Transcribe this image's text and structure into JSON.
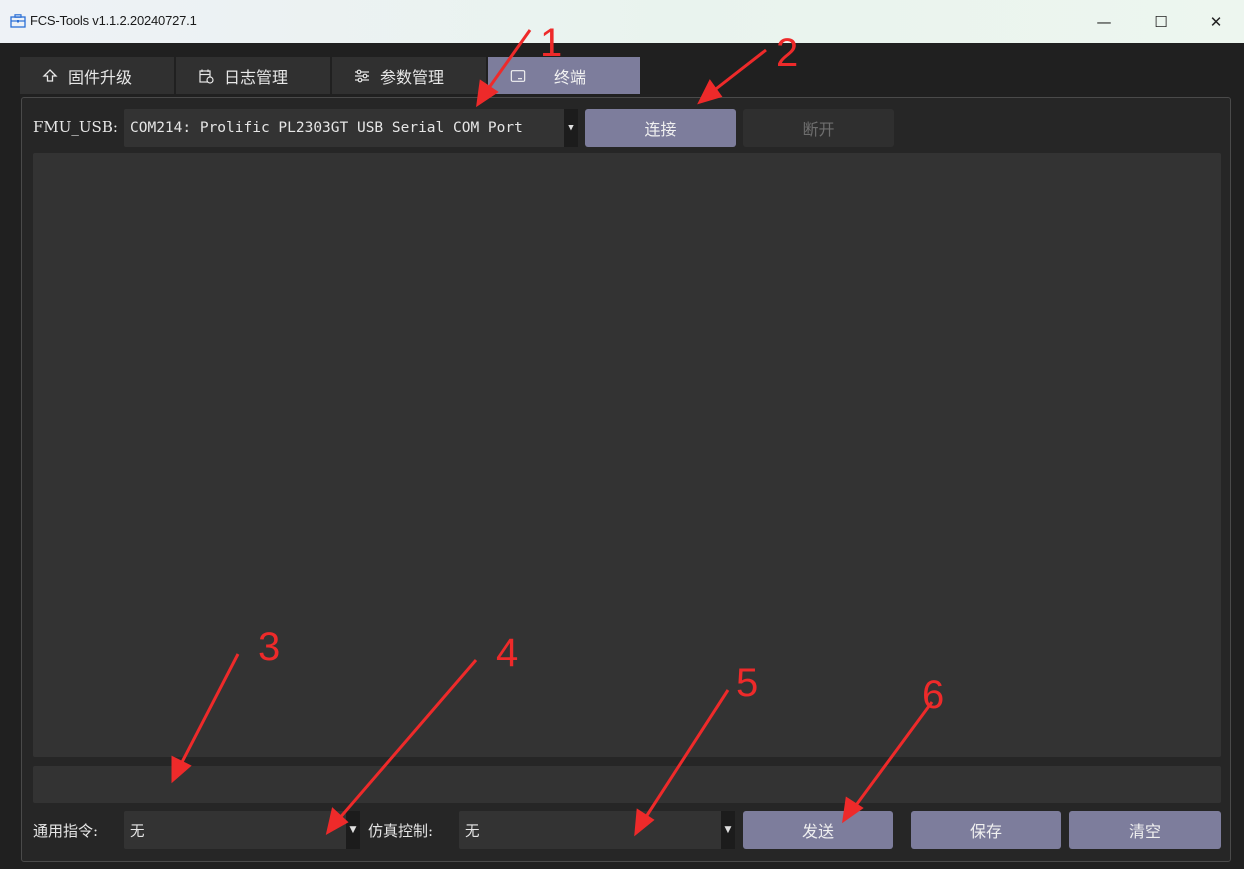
{
  "window": {
    "title": "FCS-Tools v1.1.2.20240727.1",
    "controls": {
      "minimize": "—",
      "maximize": "☐",
      "close": "✕"
    }
  },
  "tabs": [
    {
      "label": "固件升级",
      "icon": "upload-arrow-icon",
      "active": false
    },
    {
      "label": "日志管理",
      "icon": "log-calendar-icon",
      "active": false
    },
    {
      "label": "参数管理",
      "icon": "sliders-icon",
      "active": false
    },
    {
      "label": "终端",
      "icon": "terminal-icon",
      "active": true
    }
  ],
  "connection": {
    "label": "FMU_USB:",
    "port_value": "COM214: Prolific PL2303GT USB Serial COM Port",
    "connect_label": "连接",
    "disconnect_label": "断开"
  },
  "bottom_bar": {
    "common_cmd_label": "通用指令:",
    "common_cmd_value": "无",
    "sim_ctrl_label": "仿真控制:",
    "sim_ctrl_value": "无",
    "send_label": "发送",
    "save_label": "保存",
    "clear_label": "清空"
  },
  "annotations": [
    "1",
    "2",
    "3",
    "4",
    "5",
    "6"
  ],
  "colors": {
    "accent_button": "#7d7d9c",
    "annotation_red": "#ee2a2a",
    "background": "#202020",
    "field": "#333333"
  }
}
